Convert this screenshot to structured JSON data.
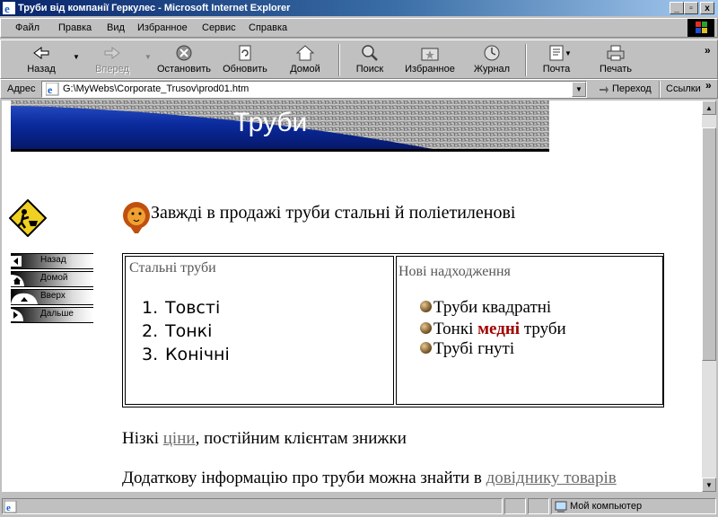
{
  "window": {
    "title": "Труби від компанії Геркулес - Microsoft Internet Explorer",
    "btn_min": "_",
    "btn_max": "▫",
    "btn_close": "x"
  },
  "menu": [
    "Файл",
    "Правка",
    "Вид",
    "Избранное",
    "Сервис",
    "Справка"
  ],
  "toolbar": {
    "back": "Назад",
    "forward": "Вперед",
    "stop": "Остановить",
    "refresh": "Обновить",
    "home": "Домой",
    "search": "Поиск",
    "favorites": "Избранное",
    "history": "Журнал",
    "mail": "Почта",
    "print": "Печать"
  },
  "address": {
    "label": "Адрес",
    "value": "G:\\MyWebs\\Corporate_Trusov\\prod01.htm",
    "go": "Переход",
    "links": "Ссылки"
  },
  "page": {
    "banner_title": "Труби",
    "headline": "Завжді в продажі труби стальні й поліетиленові",
    "nav": [
      "Назад",
      "Домой",
      "Вверх",
      "Дальше"
    ],
    "steel": {
      "title": "Стальні труби",
      "items": [
        "Товсті",
        "Тонкі",
        "Конічні"
      ],
      "numbers": [
        "1.",
        "2.",
        "3."
      ]
    },
    "news": {
      "title": "Нові надходження",
      "item1": "Труби квадратні",
      "item2_pre": "Тонкі ",
      "item2_bold": "медні",
      "item2_post": " труби",
      "item3": "Трубі гнуті"
    },
    "para1_pre": "Нізкі ",
    "para1_link": "ціни",
    "para1_post": ", постійним клієнтам знижки",
    "para2_pre": "Додаткову інформацію про труби можна знайти в ",
    "para2_link": "довіднику  товарів"
  },
  "status": {
    "zone": "Мой компьютер"
  },
  "colors": {
    "title_gradient_start": "#08246b",
    "highlight_red": "#a00000",
    "link_gray": "#6a6a6a",
    "banner_blue": "#0a2a9c"
  }
}
